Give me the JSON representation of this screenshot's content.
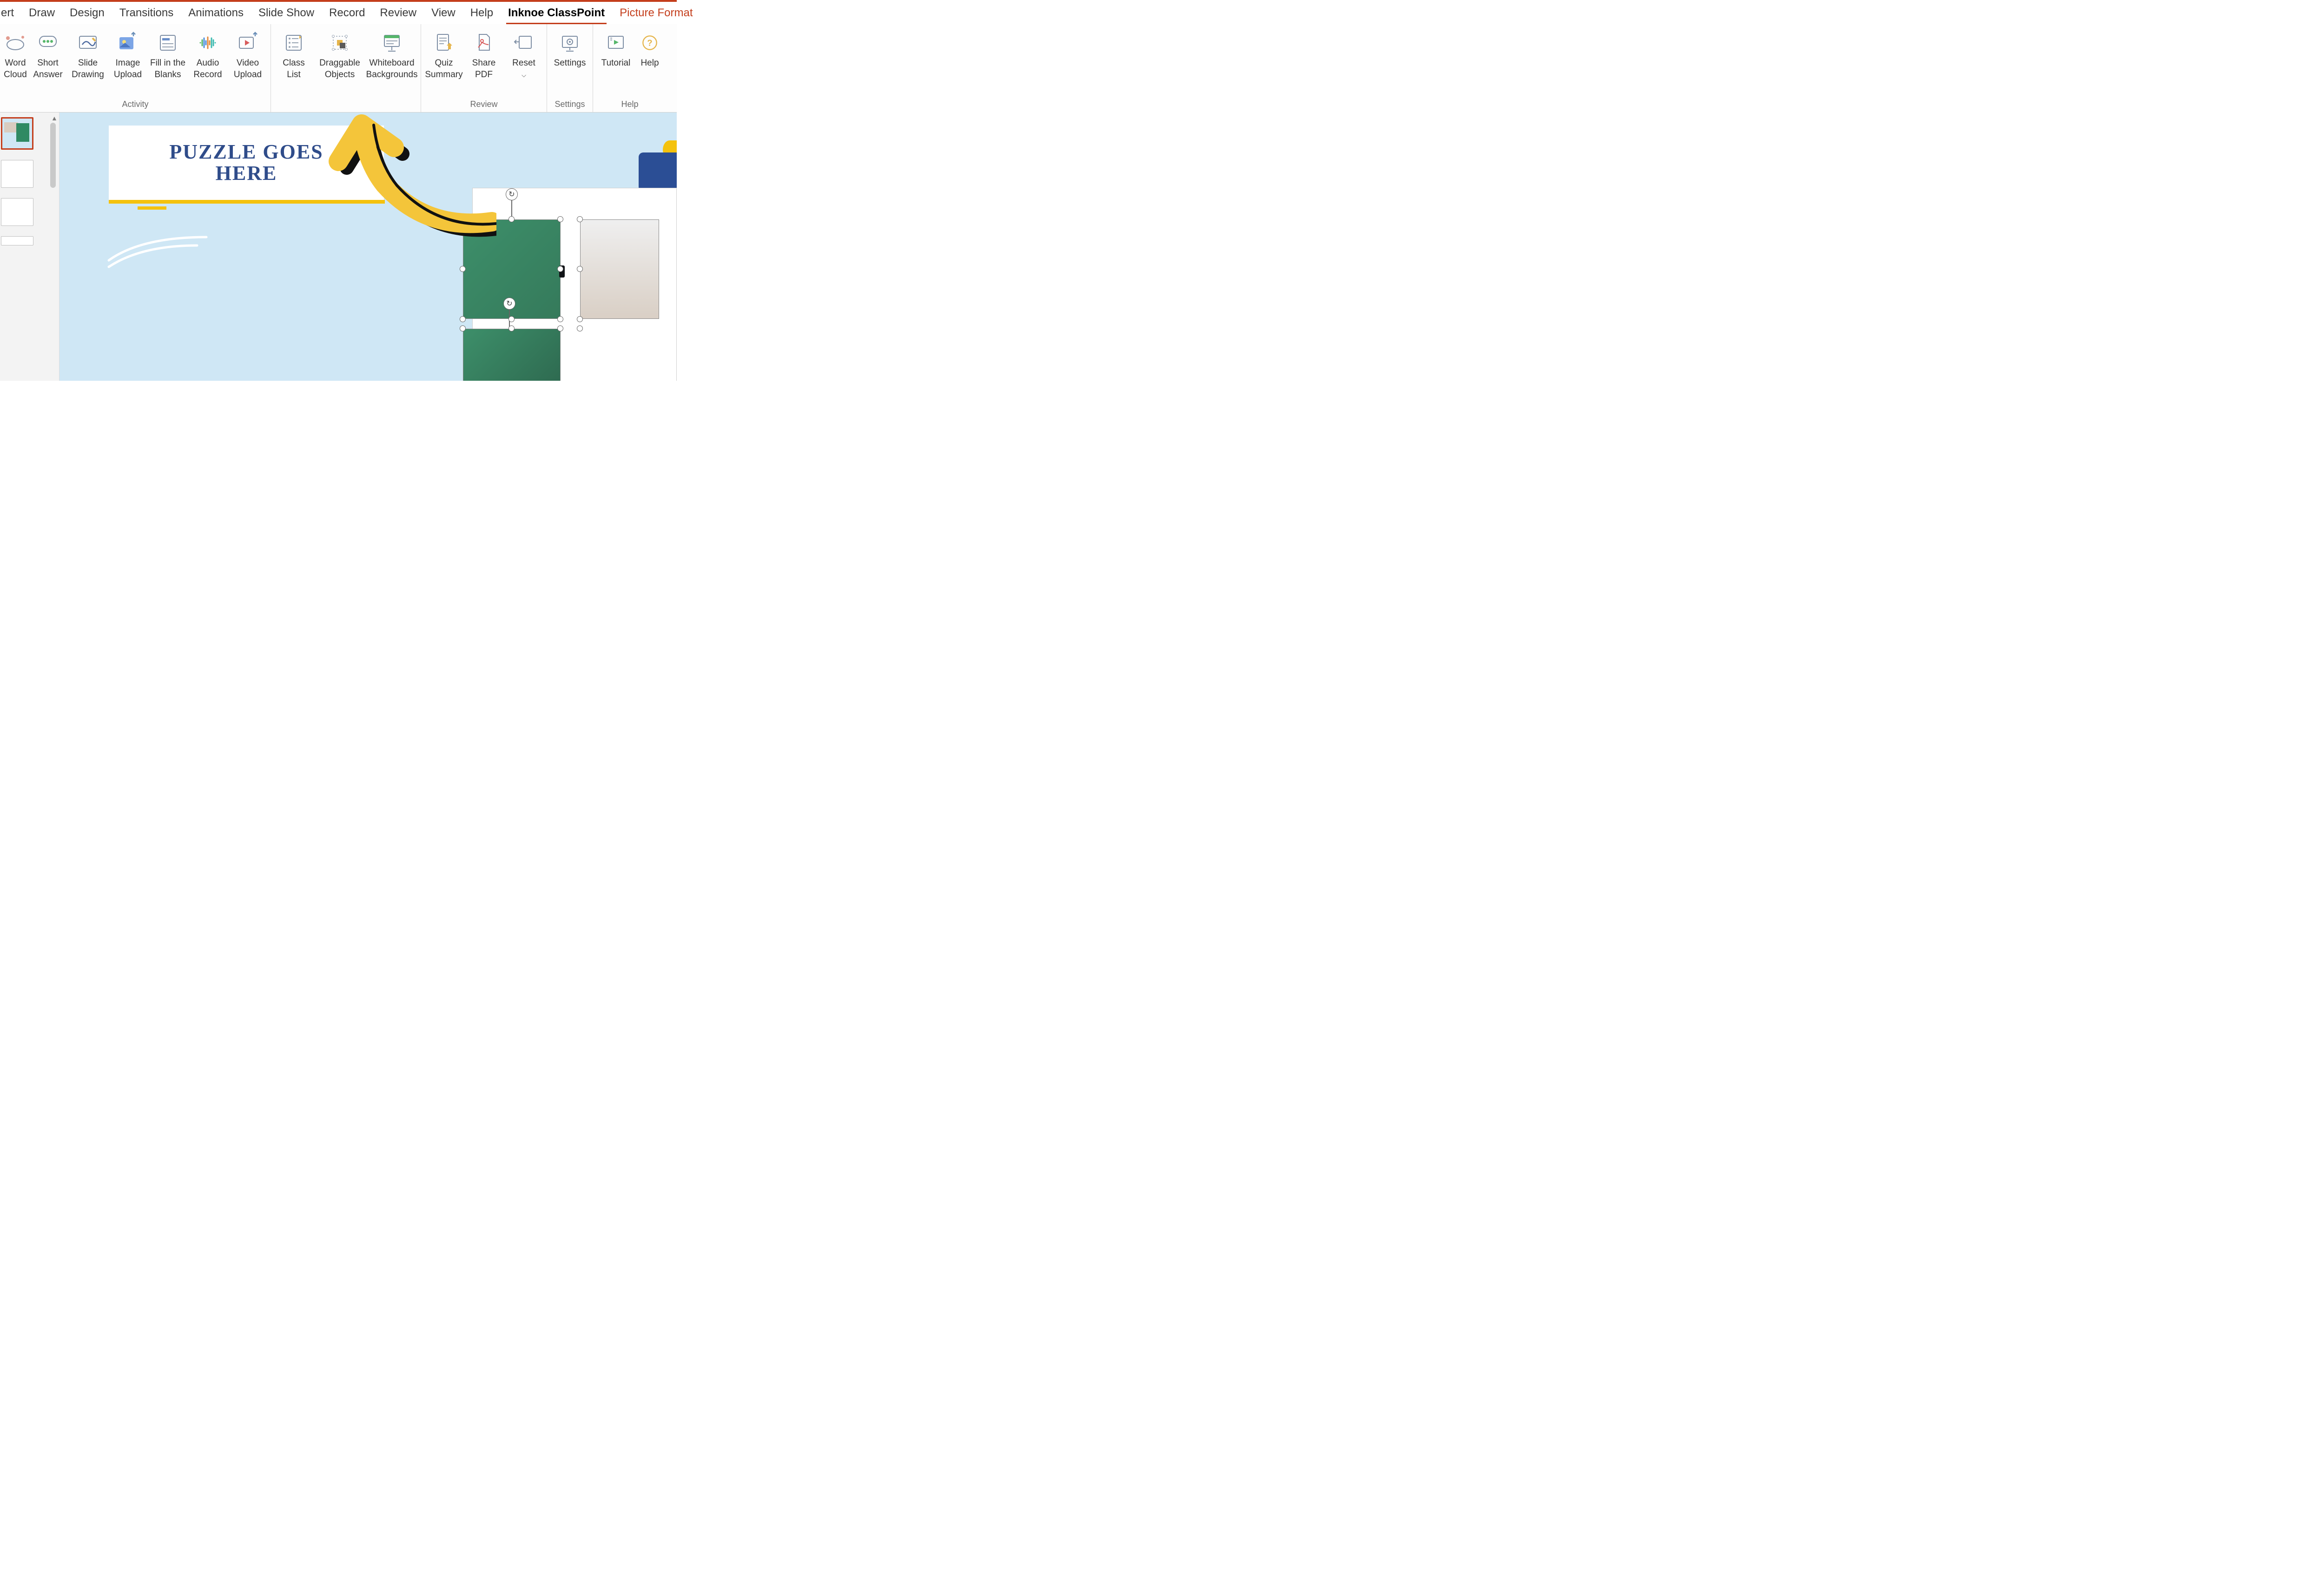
{
  "ribbon_tabs": {
    "insert": "ert",
    "draw": "Draw",
    "design": "Design",
    "transitions": "Transitions",
    "animations": "Animations",
    "slideshow": "Slide Show",
    "record": "Record",
    "review": "Review",
    "view": "View",
    "help": "Help",
    "classpoint": "Inknoe ClassPoint",
    "picture_format": "Picture Format"
  },
  "ribbon": {
    "activity": {
      "word_cloud": "Word\nCloud",
      "short_answer": "Short\nAnswer",
      "slide_drawing": "Slide\nDrawing",
      "image_upload": "Image\nUpload",
      "fill_blanks": "Fill in the\nBlanks",
      "audio_record": "Audio\nRecord",
      "video_upload": "Video\nUpload",
      "group_label": "Activity"
    },
    "tools": {
      "class_list": "Class\nList",
      "draggable": "Draggable\nObjects",
      "whiteboard": "Whiteboard\nBackgrounds"
    },
    "review": {
      "quiz_summary": "Quiz\nSummary",
      "share_pdf": "Share\nPDF",
      "reset": "Reset",
      "group_label": "Review"
    },
    "settings": {
      "settings": "Settings",
      "group_label": "Settings"
    },
    "help_group": {
      "tutorial": "Tutorial",
      "help": "Help",
      "group_label": "Help"
    }
  },
  "slide": {
    "title_line1": "PUZZLE  GOES",
    "title_line2": "HERE"
  }
}
